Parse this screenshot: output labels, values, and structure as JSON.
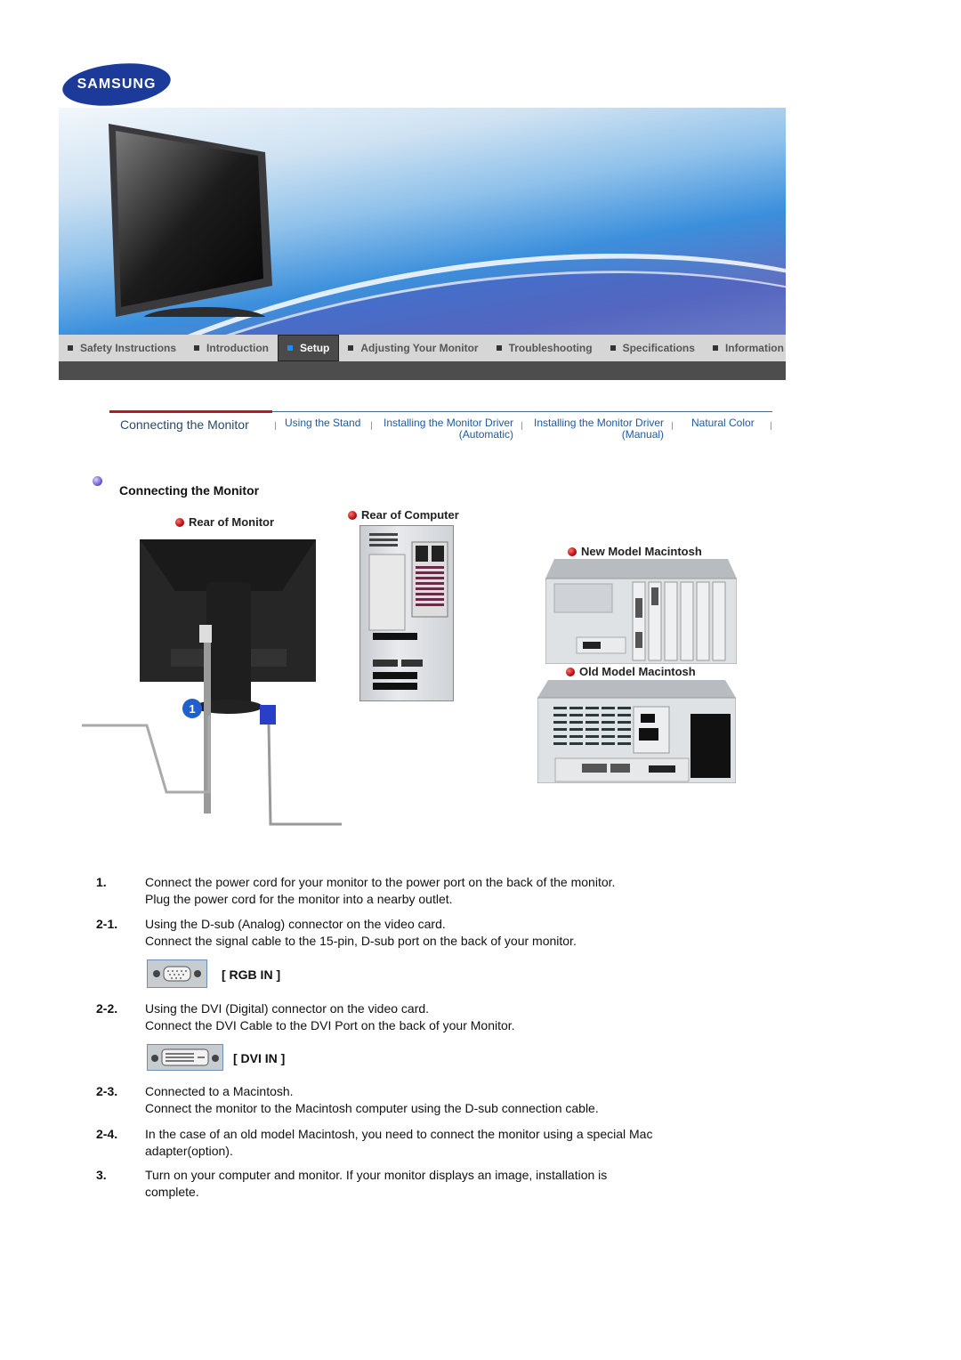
{
  "brand": {
    "logo_text": "SAMSUNG",
    "logo_color": "#1b3a9a"
  },
  "nav": {
    "items": [
      {
        "label": "Safety Instructions",
        "active": false
      },
      {
        "label": "Introduction",
        "active": false
      },
      {
        "label": "Setup",
        "active": true
      },
      {
        "label": "Adjusting Your Monitor",
        "active": false
      },
      {
        "label": "Troubleshooting",
        "active": false
      },
      {
        "label": "Specifications",
        "active": false
      },
      {
        "label": "Information",
        "active": false
      }
    ]
  },
  "subnav": {
    "items": [
      {
        "label": "Connecting the Monitor",
        "line2": "",
        "active": true
      },
      {
        "label": "Using the Stand",
        "line2": "",
        "active": false
      },
      {
        "label": "Installing the Monitor Driver",
        "line2": "(Automatic)",
        "active": false
      },
      {
        "label": "Installing the Monitor Driver",
        "line2": "(Manual)",
        "active": false
      },
      {
        "label": "Natural Color",
        "line2": "",
        "active": false
      }
    ]
  },
  "section": {
    "title": "Connecting the Monitor"
  },
  "illustrations": {
    "rear_monitor_label": "Rear of Monitor",
    "rear_computer_label": "Rear of Computer",
    "new_mac_label": "New Model Macintosh",
    "old_mac_label": "Old Model Macintosh",
    "callout_number": "1"
  },
  "steps": [
    {
      "num": "1.",
      "lines": [
        "Connect the power cord for your monitor to the power port on the back of the monitor.",
        "Plug the power cord for the monitor into a nearby outlet."
      ]
    },
    {
      "num": "2-1.",
      "lines": [
        "Using the D-sub (Analog) connector on the video card.",
        "Connect the signal cable to the 15-pin, D-sub port on the back of your monitor."
      ],
      "port_label": "[ RGB IN ]"
    },
    {
      "num": "2-2.",
      "lines": [
        "Using the DVI (Digital) connector on the video card.",
        "Connect the DVI Cable to the DVI Port on the back of your Monitor."
      ],
      "port_label": "[ DVI IN ]"
    },
    {
      "num": "2-3.",
      "lines": [
        "Connected to a Macintosh.",
        "Connect the monitor to the Macintosh computer using the D-sub connection cable."
      ]
    },
    {
      "num": "2-4.",
      "lines": [
        "In the case of an old model Macintosh, you need to connect the monitor using a special Mac",
        "adapter(option)."
      ]
    },
    {
      "num": "3.",
      "lines": [
        "Turn on your computer and monitor. If your monitor displays an image, installation is",
        "complete."
      ]
    }
  ]
}
